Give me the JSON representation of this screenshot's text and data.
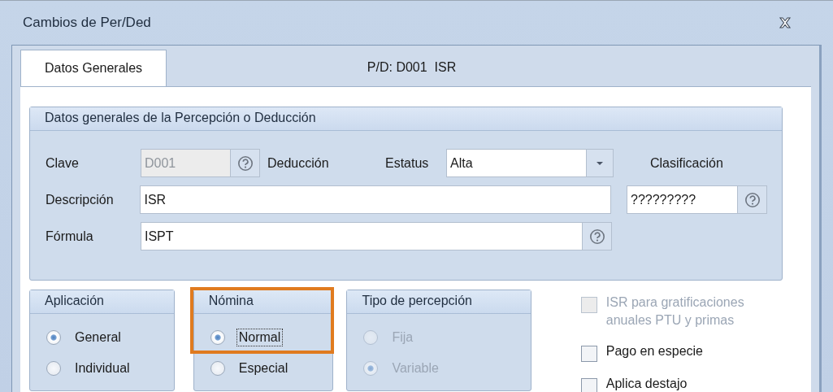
{
  "window": {
    "title": "Cambios de Per/Ded"
  },
  "tabs": [
    {
      "label": "Datos Generales",
      "selected": true
    }
  ],
  "header": "P/D: D001  ISR",
  "general_group": {
    "title": "Datos generales de la Percepción o Deducción",
    "clave": {
      "label": "Clave",
      "value": "D001",
      "disabled": true
    },
    "type_label": "Deducción",
    "estatus": {
      "label": "Estatus",
      "value": "Alta"
    },
    "clasificacion": {
      "label": "Clasificación",
      "value": "?????????"
    },
    "descripcion": {
      "label": "Descripción",
      "value": "ISR"
    },
    "formula": {
      "label": "Fórmula",
      "value": "ISPT"
    }
  },
  "option_groups": [
    {
      "title": "Aplicación",
      "highlighted": false,
      "options": [
        {
          "label": "General",
          "selected": true,
          "disabled": false,
          "focused": false
        },
        {
          "label": "Individual",
          "selected": false,
          "disabled": false,
          "focused": false
        }
      ]
    },
    {
      "title": "Nómina",
      "highlighted": true,
      "options": [
        {
          "label": "Normal",
          "selected": true,
          "disabled": false,
          "focused": true
        },
        {
          "label": "Especial",
          "selected": false,
          "disabled": false,
          "focused": false
        }
      ]
    },
    {
      "title": "Tipo de percepción",
      "highlighted": false,
      "options": [
        {
          "label": "Fija",
          "selected": false,
          "disabled": true,
          "focused": false
        },
        {
          "label": "Variable",
          "selected": true,
          "disabled": true,
          "focused": false
        }
      ]
    }
  ],
  "checkboxes": [
    {
      "label": "ISR para gratificaciones anuales PTU y primas",
      "checked": false,
      "disabled": true
    },
    {
      "label": "Pago en especie",
      "checked": false,
      "disabled": false
    },
    {
      "label": "Aplica destajo",
      "checked": false,
      "disabled": false
    }
  ]
}
